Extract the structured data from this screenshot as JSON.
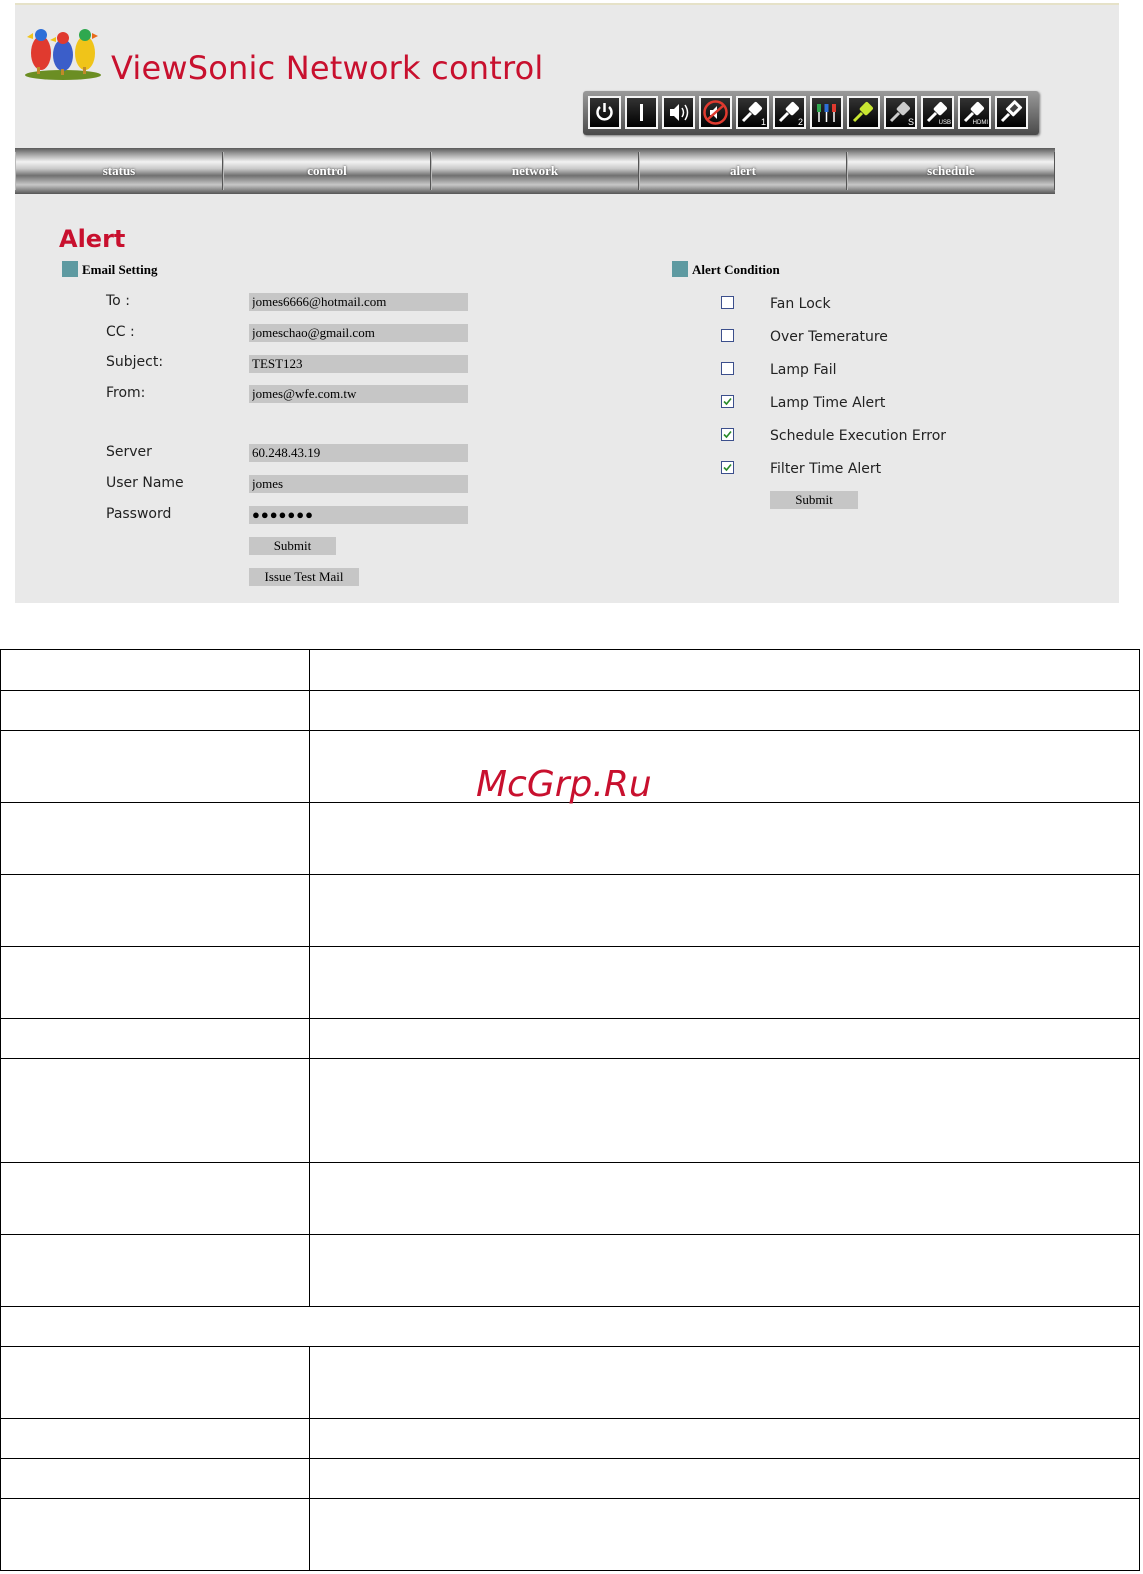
{
  "app": {
    "title": "ViewSonic Network control",
    "accent_color": "#c8102e"
  },
  "toolbar": {
    "buttons": [
      {
        "icon": "power-icon",
        "sub": ""
      },
      {
        "icon": "on-icon",
        "sub": ""
      },
      {
        "icon": "volume-icon",
        "sub": ""
      },
      {
        "icon": "mute-icon",
        "sub": ""
      },
      {
        "icon": "computer-1-icon",
        "sub": "1"
      },
      {
        "icon": "computer-2-icon",
        "sub": "2"
      },
      {
        "icon": "component-icon",
        "sub": ""
      },
      {
        "icon": "video-icon",
        "sub": ""
      },
      {
        "icon": "s-video-icon",
        "sub": "S"
      },
      {
        "icon": "usb-icon",
        "sub": "USB"
      },
      {
        "icon": "hdmi-icon",
        "sub": "HDMI"
      },
      {
        "icon": "dvi-icon",
        "sub": ""
      }
    ]
  },
  "nav": {
    "tabs": [
      {
        "label": "status"
      },
      {
        "label": "control"
      },
      {
        "label": "network"
      },
      {
        "label": "alert"
      },
      {
        "label": "schedule"
      }
    ]
  },
  "page": {
    "heading": "Alert"
  },
  "email_setting": {
    "title": "Email Setting",
    "to_label": "To :",
    "to_value": "jomes6666@hotmail.com",
    "cc_label": "CC :",
    "cc_value": "jomeschao@gmail.com",
    "subject_label": "Subject:",
    "subject_value": "TEST123",
    "from_label": "From:",
    "from_value": "jomes@wfe.com.tw",
    "server_label": "Server",
    "server_value": "60.248.43.19",
    "username_label": "User Name",
    "username_value": "jomes",
    "password_label": "Password",
    "password_value": "●●●●●●●",
    "submit_label": "Submit",
    "test_mail_label": "Issue Test Mail"
  },
  "alert_condition": {
    "title": "Alert Condition",
    "items": [
      {
        "label": "Fan Lock",
        "checked": false
      },
      {
        "label": "Over Temerature",
        "checked": false
      },
      {
        "label": "Lamp Fail",
        "checked": false
      },
      {
        "label": "Lamp Time Alert",
        "checked": true
      },
      {
        "label": "Schedule Execution Error",
        "checked": true
      },
      {
        "label": "Filter Time Alert",
        "checked": true
      }
    ],
    "submit_label": "Submit"
  },
  "watermark": "McGrp.Ru"
}
